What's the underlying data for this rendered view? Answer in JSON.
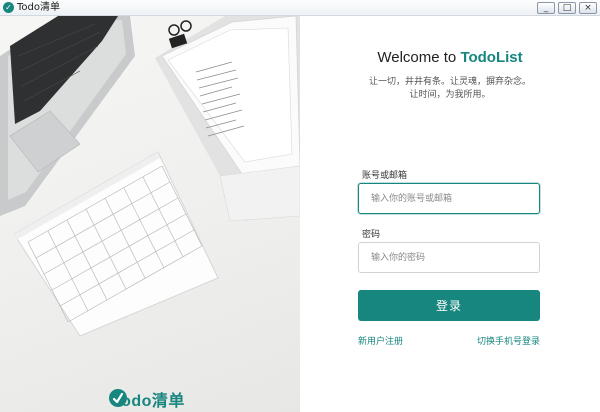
{
  "window": {
    "title": "Todo清单",
    "app_icon": "todo-app-icon",
    "controls": {
      "minimize": "_",
      "maximize": "□",
      "close": "×"
    }
  },
  "left_panel": {
    "illustration": "desk-laptop-notebook-calendar",
    "brand_name": "Todo清单",
    "brand_color": "#17867f"
  },
  "login": {
    "welcome_prefix": "Welcome to ",
    "welcome_brand": "TodoList",
    "subtitle_line1": "让一切，井井有条。让灵魂，摒弃杂念。",
    "subtitle_line2": "让时间，为我所用。",
    "account_label": "账号或邮箱",
    "account_placeholder": "输入你的账号或邮箱",
    "account_value": "",
    "password_label": "密码",
    "password_placeholder": "输入你的密码",
    "password_value": "",
    "login_button": "登录",
    "register_link": "新用户注册",
    "phone_login_link": "切换手机号登录",
    "accent_color": "#17867f"
  }
}
